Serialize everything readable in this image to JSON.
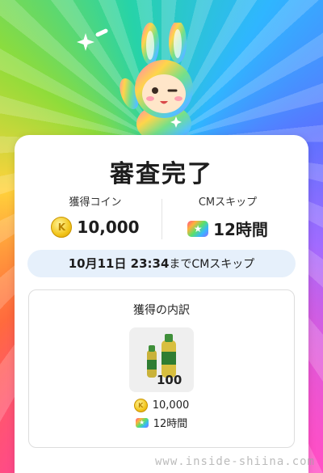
{
  "header": {
    "title": "審査完了"
  },
  "stats": {
    "coins": {
      "label": "獲得コイン",
      "value": "10,000",
      "icon": "coin-icon"
    },
    "cm_skip": {
      "label": "CMスキップ",
      "value": "12時間",
      "icon": "cm-skip-icon"
    }
  },
  "notice": {
    "date": "10月11日 23:34",
    "suffix": "までCMスキップ"
  },
  "breakdown": {
    "title": "獲得の内訳",
    "product_badge": "100",
    "items": [
      {
        "icon": "coin-icon",
        "value": "10,000"
      },
      {
        "icon": "cm-skip-icon",
        "value": "12時間"
      }
    ]
  },
  "watermark": "www.inside-shiina.com",
  "colors": {
    "card": "#ffffff",
    "pill_bg": "#e6f0fb",
    "coin": "#f2c51c"
  }
}
